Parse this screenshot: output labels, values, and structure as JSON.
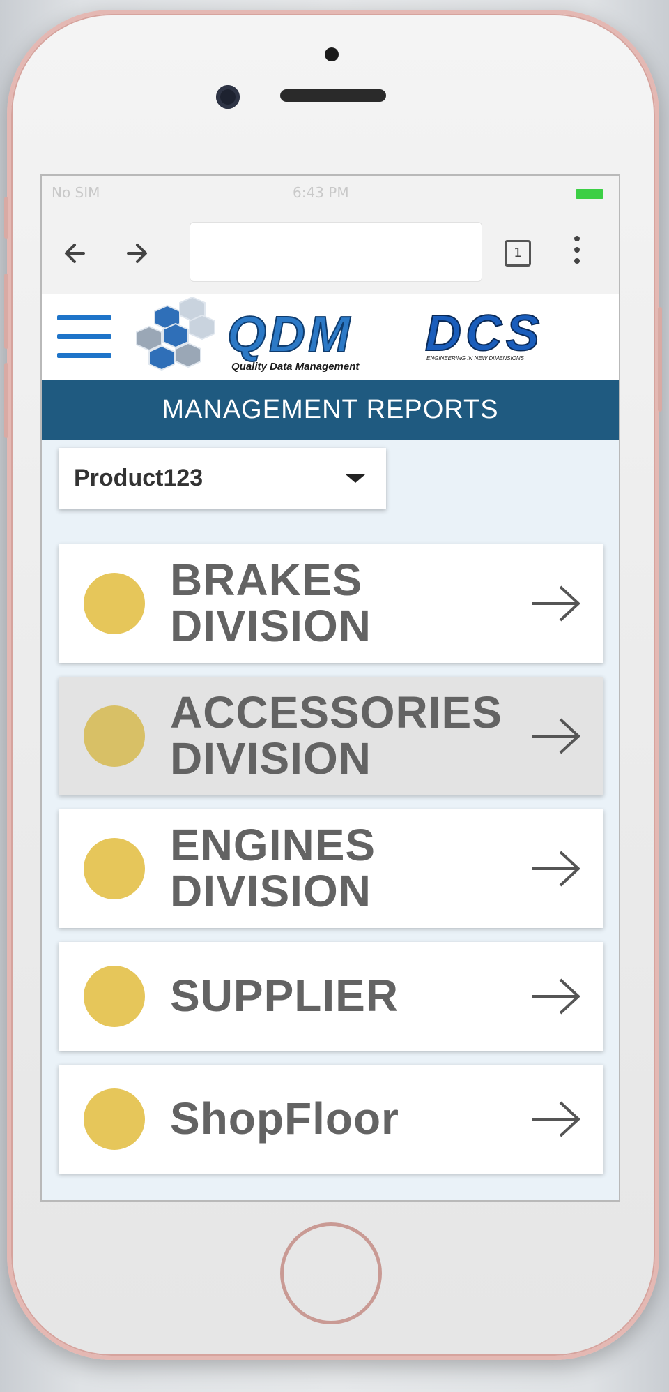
{
  "status_bar": {
    "carrier": "No SIM",
    "time": "6:43 PM"
  },
  "browser": {
    "back_icon": "arrow-left-icon",
    "forward_icon": "arrow-right-icon",
    "address_value": "",
    "tab_count": "1",
    "menu_icon": "more-vertical-icon"
  },
  "header": {
    "menu_icon": "hamburger-icon",
    "logo_text": "QDM",
    "logo_tagline": "Quality Data Management",
    "partner_logo_text": "DCS",
    "partner_tagline": "ENGINEERING IN NEW DIMENSIONS"
  },
  "section": {
    "title": "MANAGEMENT REPORTS"
  },
  "product_select": {
    "value": "Product123"
  },
  "divisions": [
    {
      "line1": "BRAKES",
      "line2": "DIVISION",
      "status_color": "#e6c65a"
    },
    {
      "line1": "ACCESSORIES",
      "line2": "DIVISION",
      "status_color": "#d8c066"
    },
    {
      "line1": "ENGINES",
      "line2": "DIVISION",
      "status_color": "#e6c65a"
    },
    {
      "line1": "SUPPLIER",
      "line2": "",
      "status_color": "#e6c65a"
    },
    {
      "line1": "ShopFloor",
      "line2": "",
      "status_color": "#e6c65a"
    }
  ],
  "colors": {
    "accent_blue": "#1e74c9",
    "band": "#1f5a80",
    "status_yellow": "#e6c65a"
  }
}
